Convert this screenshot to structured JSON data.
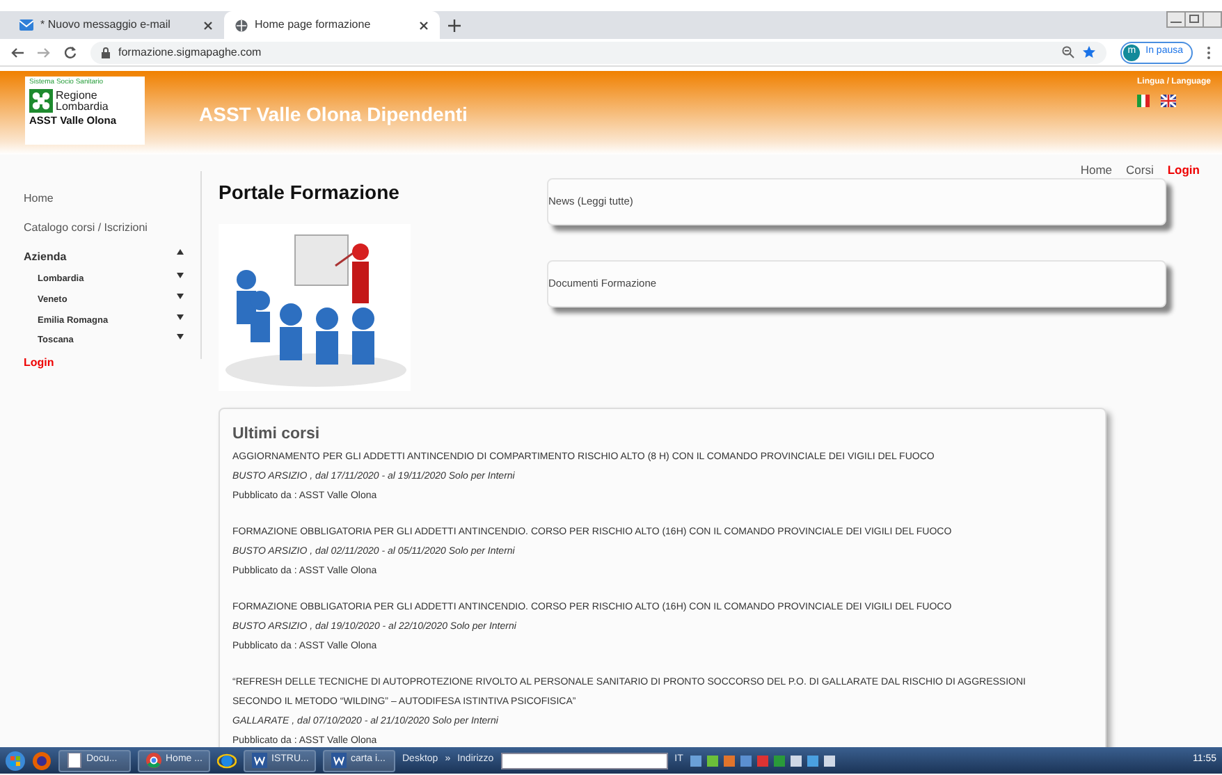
{
  "browser": {
    "tabs": [
      {
        "title": "* Nuovo messaggio e-mail",
        "kind": "mail",
        "selected": false
      },
      {
        "title": "Home page formazione",
        "kind": "web",
        "selected": true
      }
    ],
    "url": "formazione.sigmapaghe.com",
    "profile": {
      "initial": "m",
      "label": "In pausa"
    }
  },
  "header": {
    "logo": {
      "tagline": "Sistema Socio Sanitario",
      "region": "Regione",
      "region_2": "Lombardia",
      "name": "ASST Valle Olona"
    },
    "title": "ASST Valle Olona Dipendenti",
    "language": "Lingua / Language"
  },
  "top_nav": [
    {
      "label": "Home",
      "kind": "link"
    },
    {
      "label": "Corsi",
      "kind": "link"
    },
    {
      "label": "Login",
      "kind": "login"
    }
  ],
  "sidebar": [
    {
      "label": "Home",
      "kind": "link"
    },
    {
      "label": "Catalogo corsi / Iscrizioni",
      "kind": "link"
    },
    {
      "label": "Azienda",
      "kind": "group",
      "expanded": true,
      "children": [
        {
          "label": "Lombardia",
          "expanded": false
        },
        {
          "label": "Veneto",
          "expanded": false
        },
        {
          "label": "Emilia Romagna",
          "expanded": false
        },
        {
          "label": "Toscana",
          "expanded": false
        }
      ]
    },
    {
      "label": "Login",
      "kind": "login"
    }
  ],
  "page_title": "Portale Formazione",
  "panels": [
    "News (Leggi tutte)",
    "Documenti Formazione"
  ],
  "courses": {
    "title": "Ultimi corsi",
    "items": [
      {
        "title": "AGGIORNAMENTO PER GLI ADDETTI ANTINCENDIO DI COMPARTIMENTO RISCHIO ALTO (8 H) CON IL COMANDO PROVINCIALE DEI VIGILI DEL FUOCO",
        "details": "BUSTO ARSIZIO , dal 17/11/2020 - al 19/11/2020 Solo per Interni",
        "publisher": "Pubblicato da : ASST Valle Olona"
      },
      {
        "title": "FORMAZIONE OBBLIGATORIA PER GLI ADDETTI ANTINCENDIO. CORSO PER RISCHIO ALTO (16H) CON IL COMANDO PROVINCIALE DEI VIGILI DEL FUOCO",
        "details": "BUSTO ARSIZIO , dal 02/11/2020 - al 05/11/2020 Solo per Interni",
        "publisher": "Pubblicato da : ASST Valle Olona"
      },
      {
        "title": "FORMAZIONE OBBLIGATORIA PER GLI ADDETTI ANTINCENDIO. CORSO PER RISCHIO ALTO (16H) CON IL COMANDO PROVINCIALE DEI VIGILI DEL FUOCO",
        "details": "BUSTO ARSIZIO , dal 19/10/2020 - al 22/10/2020 Solo per Interni",
        "publisher": "Pubblicato da : ASST Valle Olona"
      },
      {
        "title": "“REFRESH DELLE TECNICHE DI AUTOPROTEZIONE RIVOLTO AL PERSONALE SANITARIO DI PRONTO SOCCORSO DEL P.O. DI GALLARATE DAL RISCHIO DI AGGRESSIONI SECONDO IL METODO “WILDING” – AUTODIFESA ISTINTIVA PSICOFISICA”",
        "details": "GALLARATE , dal 07/10/2020 - al 21/10/2020 Solo per Interni",
        "publisher": "Pubblicato da : ASST Valle Olona"
      }
    ]
  },
  "taskbar": {
    "items": [
      {
        "kind": "start"
      },
      {
        "kind": "firefox"
      },
      {
        "kind": "doc",
        "label": "Docu..."
      },
      {
        "kind": "chrome",
        "label": "Home ..."
      },
      {
        "kind": "ie"
      },
      {
        "kind": "word",
        "label": "ISTRU..."
      },
      {
        "kind": "word",
        "label": "carta i..."
      }
    ],
    "desktop": "Desktop",
    "more": "»",
    "address_label": "Indirizzo",
    "language": "IT",
    "time": "11:55"
  }
}
